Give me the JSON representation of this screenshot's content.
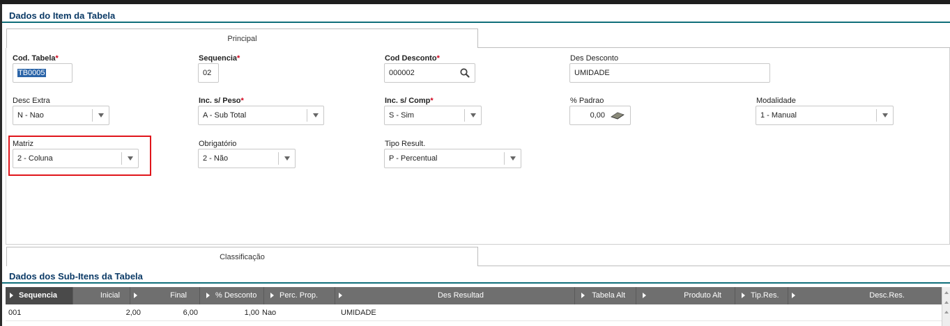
{
  "header": {
    "title": "Dados do Item da Tabela"
  },
  "tabs": {
    "principal": "Principal",
    "classificacao": "Classificação"
  },
  "fields": {
    "cod_tabela": {
      "label": "Cod. Tabela",
      "required": "*",
      "value": "TB0005"
    },
    "sequencia": {
      "label": "Sequencia",
      "required": "*",
      "value": "02"
    },
    "cod_desconto": {
      "label": "Cod Desconto",
      "required": "*",
      "value": "000002",
      "icon": "search-icon"
    },
    "des_desconto": {
      "label": "Des Desconto",
      "value": "UMIDADE"
    },
    "desc_extra": {
      "label": "Desc Extra",
      "value": "N - Nao"
    },
    "inc_peso": {
      "label": "Inc. s/ Peso",
      "required": "*",
      "value": "A - Sub Total"
    },
    "inc_comp": {
      "label": "Inc. s/ Comp",
      "required": "*",
      "value": "S - Sim"
    },
    "padrao": {
      "label": "% Padrao",
      "value": "0,00",
      "icon": "calculator-icon"
    },
    "modalidade": {
      "label": "Modalidade",
      "value": "1 - Manual"
    },
    "matriz": {
      "label": "Matriz",
      "value": "2 - Coluna"
    },
    "obrigatorio": {
      "label": "Obrigatório",
      "value": "2 - Não"
    },
    "tipo_result": {
      "label": "Tipo Result.",
      "value": "P - Percentual"
    }
  },
  "subitens": {
    "title": "Dados dos Sub-Itens da Tabela",
    "columns": [
      "Sequencia",
      "Inicial",
      "Final",
      "% Desconto",
      "Perc. Prop.",
      "Des Resultad",
      "Tabela Alt",
      "Produto Alt",
      "Tip.Res.",
      "Desc.Res."
    ],
    "rows": [
      [
        "001",
        "2,00",
        "6,00",
        "1,00",
        "Nao",
        "UMIDADE",
        "",
        "",
        "",
        ""
      ]
    ]
  },
  "colors": {
    "accent": "#0f6e7a",
    "title": "#0b3a66",
    "required": "#d0021b",
    "highlight": "#e0151b",
    "grid_header": "#6f6f6f"
  }
}
